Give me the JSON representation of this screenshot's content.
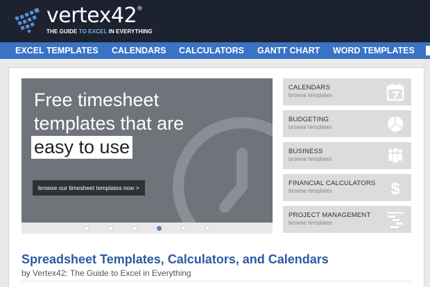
{
  "brand": {
    "name": "vertex42",
    "trademark": "®",
    "tagline_prefix": "THE GUIDE ",
    "tagline_highlight": "TO EXCEL",
    "tagline_suffix": " IN EVERYTHING",
    "colors": {
      "header_bg": "#1c2230",
      "nav_bg": "#3a72c4",
      "accent_blue": "#7fb2ee"
    }
  },
  "nav": {
    "items": [
      "EXCEL TEMPLATES",
      "CALENDARS",
      "CALCULATORS",
      "GANTT CHART",
      "WORD TEMPLATES"
    ]
  },
  "hero": {
    "line1": "Free timesheet",
    "line2": "templates that are",
    "highlight": "easy to use",
    "button": "browse our timesheet templates now >",
    "slide_count": 6,
    "active_slide": 4
  },
  "tiles": [
    {
      "title": "CALENDARS",
      "subtitle": "browse templates",
      "icon": "calendar-icon"
    },
    {
      "title": "BUDGETING",
      "subtitle": "browse templates",
      "icon": "pie-chart-icon"
    },
    {
      "title": "BUSINESS",
      "subtitle": "browse templates",
      "icon": "people-icon"
    },
    {
      "title": "FINANCIAL CALCULATORS",
      "subtitle": "browse templates",
      "icon": "dollar-icon"
    },
    {
      "title": "PROJECT MANAGEMENT",
      "subtitle": "browse templates",
      "icon": "gantt-icon"
    }
  ],
  "page": {
    "title": "Spreadsheet Templates, Calculators, and Calendars",
    "byline": "by Vertex42: The Guide to Excel in Everything"
  }
}
